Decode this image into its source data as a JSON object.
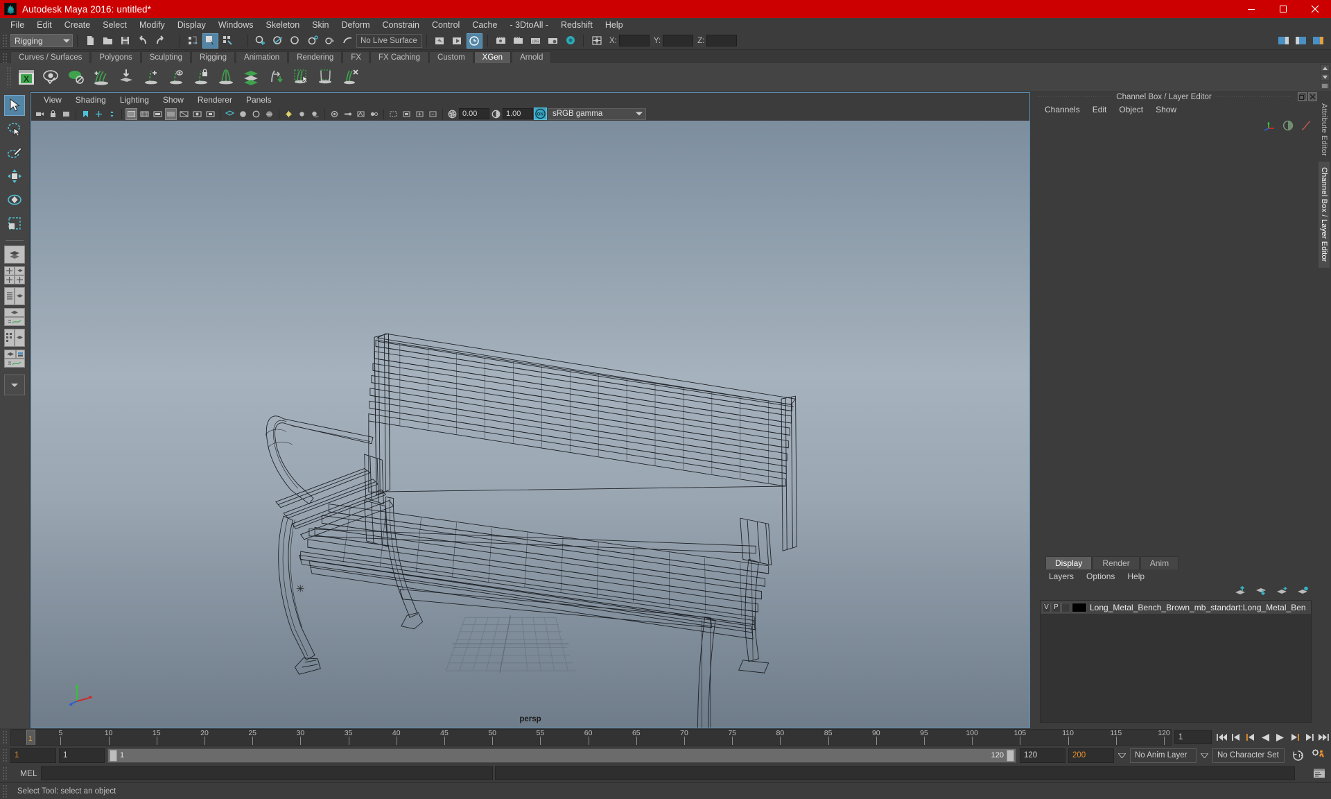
{
  "window": {
    "title": "Autodesk Maya 2016: untitled*",
    "icon": "maya-logo-icon",
    "minimize": "–",
    "maximize": "▭",
    "close": "✕",
    "titlebar_color": "#cc0000"
  },
  "menubar": {
    "items": [
      {
        "label": "File"
      },
      {
        "label": "Edit"
      },
      {
        "label": "Create"
      },
      {
        "label": "Select"
      },
      {
        "label": "Modify"
      },
      {
        "label": "Display"
      },
      {
        "label": "Windows"
      },
      {
        "label": "Skeleton"
      },
      {
        "label": "Skin"
      },
      {
        "label": "Deform"
      },
      {
        "label": "Constrain"
      },
      {
        "label": "Control"
      },
      {
        "label": "Cache"
      },
      {
        "label": "- 3DtoAll -"
      },
      {
        "label": "Redshift"
      },
      {
        "label": "Help"
      }
    ]
  },
  "statusline": {
    "menu_set": "Rigging",
    "live_surface": "No Live Surface",
    "coord_labels": {
      "x": "X:",
      "y": "Y:",
      "z": "Z:"
    },
    "coord_values": {
      "x": "",
      "y": "",
      "z": ""
    }
  },
  "shelf": {
    "tabs": [
      {
        "label": "Curves / Surfaces",
        "active": false
      },
      {
        "label": "Polygons",
        "active": false
      },
      {
        "label": "Sculpting",
        "active": false
      },
      {
        "label": "Rigging",
        "active": false
      },
      {
        "label": "Animation",
        "active": false
      },
      {
        "label": "Rendering",
        "active": false
      },
      {
        "label": "FX",
        "active": false
      },
      {
        "label": "FX Caching",
        "active": false
      },
      {
        "label": "Custom",
        "active": false
      },
      {
        "label": "XGen",
        "active": true
      },
      {
        "label": "Arnold",
        "active": false
      }
    ],
    "icons": [
      "xgen-editor-icon",
      "xgen-preview-icon",
      "xgen-disable-preview-icon",
      "xgen-add-description-icon",
      "xgen-import-collection-icon",
      "xgen-add-guide-icon",
      "xgen-select-guide-icon",
      "xgen-freeze-guide-icon",
      "xgen-mirror-guide-icon",
      "xgen-sculpt-layer-icon",
      "xgen-convert-icon",
      "xgen-select-primitive-icon",
      "xgen-clump-icon",
      "xgen-cut-primitive-icon"
    ]
  },
  "toolbox": {
    "tools": [
      {
        "name": "select-tool",
        "active": true
      },
      {
        "name": "lasso-select-tool",
        "active": false
      },
      {
        "name": "paint-select-tool",
        "active": false
      },
      {
        "name": "move-tool",
        "active": false
      },
      {
        "name": "rotate-tool",
        "active": false
      },
      {
        "name": "scale-tool",
        "active": false
      }
    ],
    "layouts": [
      "single-perspective-layout",
      "four-view-layout",
      "outliner-persp-layout",
      "persp-graph-layout",
      "hypershade-persp-layout",
      "persp-graph-outliner-layout",
      "more-layouts-dropdown"
    ]
  },
  "viewport": {
    "menus": [
      {
        "label": "View"
      },
      {
        "label": "Shading"
      },
      {
        "label": "Lighting"
      },
      {
        "label": "Show"
      },
      {
        "label": "Renderer"
      },
      {
        "label": "Panels"
      }
    ],
    "exposure": "0.00",
    "gamma": "1.00",
    "color_transform": "sRGB gamma",
    "view_toggle_badge": "ON",
    "camera_label": "persp",
    "model": "long-metal-bench-wireframe",
    "background_top": "#7c8d9e",
    "background_bottom": "#6f7c89"
  },
  "right_dock": {
    "title": "Channel Box / Layer Editor",
    "float_button": "❐",
    "close_button": "✕",
    "channelbox_menus": [
      {
        "label": "Channels"
      },
      {
        "label": "Edit"
      },
      {
        "label": "Object"
      },
      {
        "label": "Show"
      }
    ],
    "vertical_tabs": [
      {
        "label": "Attribute Editor",
        "selected": false
      },
      {
        "label": "Channel Box / Layer Editor",
        "selected": true
      }
    ]
  },
  "layer_editor": {
    "tabs": [
      {
        "label": "Display",
        "active": true
      },
      {
        "label": "Render",
        "active": false
      },
      {
        "label": "Anim",
        "active": false
      }
    ],
    "menus": [
      {
        "label": "Layers"
      },
      {
        "label": "Options"
      },
      {
        "label": "Help"
      }
    ],
    "buttons": [
      "move-layer-up-icon",
      "move-layer-down-icon",
      "new-layer-icon",
      "new-layer-from-selected-icon"
    ],
    "layers": [
      {
        "visibility": "V",
        "playback": "P",
        "display_type": "",
        "color": "#000000",
        "name": "Long_Metal_Bench_Brown_mb_standart:Long_Metal_Ben"
      }
    ]
  },
  "timeline": {
    "start": 1,
    "end": 120,
    "current_frame": "1",
    "tick_step": 5,
    "tick_labels": [
      5,
      10,
      15,
      20,
      25,
      30,
      35,
      40,
      45,
      50,
      55,
      60,
      65,
      70,
      75,
      80,
      85,
      90,
      95,
      100,
      105,
      110,
      115,
      120
    ],
    "current_frame_marker": "1",
    "playback_buttons": [
      "go-to-start-icon",
      "step-back-frame-icon",
      "step-back-key-icon",
      "play-backwards-icon",
      "play-forwards-icon",
      "step-forward-key-icon",
      "step-forward-frame-icon",
      "go-to-end-icon"
    ]
  },
  "range_slider": {
    "anim_start": "1",
    "playback_start": "1",
    "range_left_label": "1",
    "range_right_label": "120",
    "playback_end": "120",
    "anim_end": "200",
    "anim_layer": "No Anim Layer",
    "character_set": "No Character Set",
    "auto_key_icon": "auto-keyframe-icon",
    "prefs_icon": "animation-preferences-icon"
  },
  "command_line": {
    "label": "MEL",
    "value": "",
    "result": "",
    "script_editor_icon": "script-editor-icon"
  },
  "help_line": {
    "text": "Select Tool: select an object"
  }
}
